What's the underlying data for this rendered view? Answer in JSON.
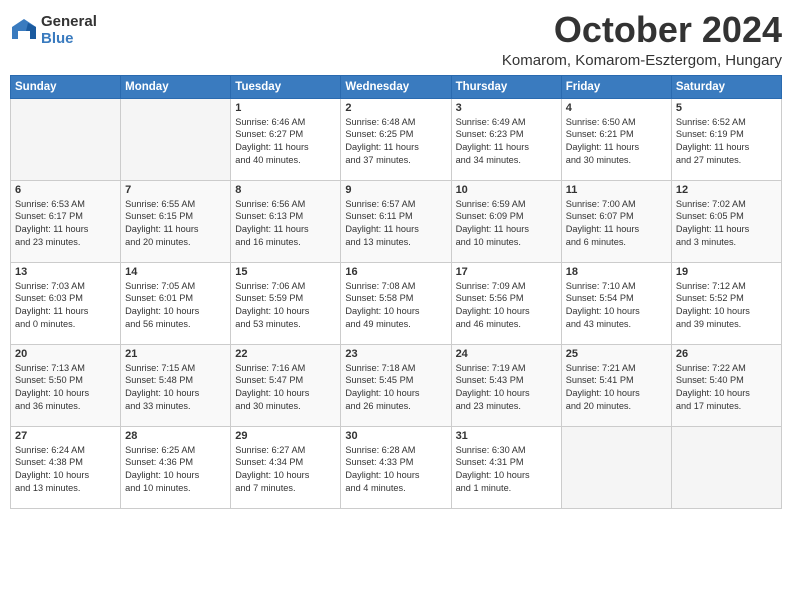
{
  "logo": {
    "general": "General",
    "blue": "Blue"
  },
  "title": "October 2024",
  "location": "Komarom, Komarom-Esztergom, Hungary",
  "headers": [
    "Sunday",
    "Monday",
    "Tuesday",
    "Wednesday",
    "Thursday",
    "Friday",
    "Saturday"
  ],
  "weeks": [
    [
      {
        "day": "",
        "detail": ""
      },
      {
        "day": "",
        "detail": ""
      },
      {
        "day": "1",
        "detail": "Sunrise: 6:46 AM\nSunset: 6:27 PM\nDaylight: 11 hours\nand 40 minutes."
      },
      {
        "day": "2",
        "detail": "Sunrise: 6:48 AM\nSunset: 6:25 PM\nDaylight: 11 hours\nand 37 minutes."
      },
      {
        "day": "3",
        "detail": "Sunrise: 6:49 AM\nSunset: 6:23 PM\nDaylight: 11 hours\nand 34 minutes."
      },
      {
        "day": "4",
        "detail": "Sunrise: 6:50 AM\nSunset: 6:21 PM\nDaylight: 11 hours\nand 30 minutes."
      },
      {
        "day": "5",
        "detail": "Sunrise: 6:52 AM\nSunset: 6:19 PM\nDaylight: 11 hours\nand 27 minutes."
      }
    ],
    [
      {
        "day": "6",
        "detail": "Sunrise: 6:53 AM\nSunset: 6:17 PM\nDaylight: 11 hours\nand 23 minutes."
      },
      {
        "day": "7",
        "detail": "Sunrise: 6:55 AM\nSunset: 6:15 PM\nDaylight: 11 hours\nand 20 minutes."
      },
      {
        "day": "8",
        "detail": "Sunrise: 6:56 AM\nSunset: 6:13 PM\nDaylight: 11 hours\nand 16 minutes."
      },
      {
        "day": "9",
        "detail": "Sunrise: 6:57 AM\nSunset: 6:11 PM\nDaylight: 11 hours\nand 13 minutes."
      },
      {
        "day": "10",
        "detail": "Sunrise: 6:59 AM\nSunset: 6:09 PM\nDaylight: 11 hours\nand 10 minutes."
      },
      {
        "day": "11",
        "detail": "Sunrise: 7:00 AM\nSunset: 6:07 PM\nDaylight: 11 hours\nand 6 minutes."
      },
      {
        "day": "12",
        "detail": "Sunrise: 7:02 AM\nSunset: 6:05 PM\nDaylight: 11 hours\nand 3 minutes."
      }
    ],
    [
      {
        "day": "13",
        "detail": "Sunrise: 7:03 AM\nSunset: 6:03 PM\nDaylight: 11 hours\nand 0 minutes."
      },
      {
        "day": "14",
        "detail": "Sunrise: 7:05 AM\nSunset: 6:01 PM\nDaylight: 10 hours\nand 56 minutes."
      },
      {
        "day": "15",
        "detail": "Sunrise: 7:06 AM\nSunset: 5:59 PM\nDaylight: 10 hours\nand 53 minutes."
      },
      {
        "day": "16",
        "detail": "Sunrise: 7:08 AM\nSunset: 5:58 PM\nDaylight: 10 hours\nand 49 minutes."
      },
      {
        "day": "17",
        "detail": "Sunrise: 7:09 AM\nSunset: 5:56 PM\nDaylight: 10 hours\nand 46 minutes."
      },
      {
        "day": "18",
        "detail": "Sunrise: 7:10 AM\nSunset: 5:54 PM\nDaylight: 10 hours\nand 43 minutes."
      },
      {
        "day": "19",
        "detail": "Sunrise: 7:12 AM\nSunset: 5:52 PM\nDaylight: 10 hours\nand 39 minutes."
      }
    ],
    [
      {
        "day": "20",
        "detail": "Sunrise: 7:13 AM\nSunset: 5:50 PM\nDaylight: 10 hours\nand 36 minutes."
      },
      {
        "day": "21",
        "detail": "Sunrise: 7:15 AM\nSunset: 5:48 PM\nDaylight: 10 hours\nand 33 minutes."
      },
      {
        "day": "22",
        "detail": "Sunrise: 7:16 AM\nSunset: 5:47 PM\nDaylight: 10 hours\nand 30 minutes."
      },
      {
        "day": "23",
        "detail": "Sunrise: 7:18 AM\nSunset: 5:45 PM\nDaylight: 10 hours\nand 26 minutes."
      },
      {
        "day": "24",
        "detail": "Sunrise: 7:19 AM\nSunset: 5:43 PM\nDaylight: 10 hours\nand 23 minutes."
      },
      {
        "day": "25",
        "detail": "Sunrise: 7:21 AM\nSunset: 5:41 PM\nDaylight: 10 hours\nand 20 minutes."
      },
      {
        "day": "26",
        "detail": "Sunrise: 7:22 AM\nSunset: 5:40 PM\nDaylight: 10 hours\nand 17 minutes."
      }
    ],
    [
      {
        "day": "27",
        "detail": "Sunrise: 6:24 AM\nSunset: 4:38 PM\nDaylight: 10 hours\nand 13 minutes."
      },
      {
        "day": "28",
        "detail": "Sunrise: 6:25 AM\nSunset: 4:36 PM\nDaylight: 10 hours\nand 10 minutes."
      },
      {
        "day": "29",
        "detail": "Sunrise: 6:27 AM\nSunset: 4:34 PM\nDaylight: 10 hours\nand 7 minutes."
      },
      {
        "day": "30",
        "detail": "Sunrise: 6:28 AM\nSunset: 4:33 PM\nDaylight: 10 hours\nand 4 minutes."
      },
      {
        "day": "31",
        "detail": "Sunrise: 6:30 AM\nSunset: 4:31 PM\nDaylight: 10 hours\nand 1 minute."
      },
      {
        "day": "",
        "detail": ""
      },
      {
        "day": "",
        "detail": ""
      }
    ]
  ]
}
